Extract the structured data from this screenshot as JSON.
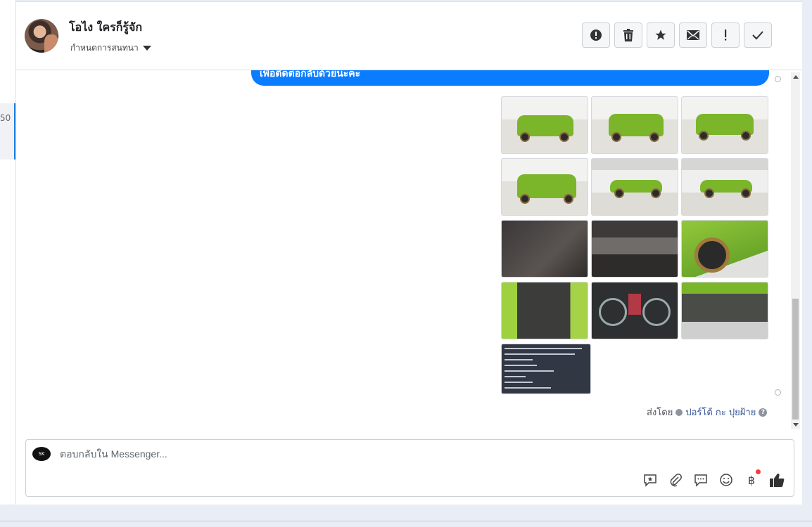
{
  "sidebar": {
    "unread_count": "50"
  },
  "header": {
    "contact_name": "โอไง ใครก็รู้จัก",
    "assign_label": "กำหนดการสนทนา",
    "actions": [
      {
        "name": "report-spam-button",
        "icon": "alert-circle-icon"
      },
      {
        "name": "delete-button",
        "icon": "trash-icon"
      },
      {
        "name": "star-button",
        "icon": "star-icon"
      },
      {
        "name": "mark-unread-button",
        "icon": "envelope-icon"
      },
      {
        "name": "follow-up-button",
        "icon": "exclamation-icon"
      },
      {
        "name": "mark-done-button",
        "icon": "checkmark-icon"
      }
    ]
  },
  "chat": {
    "last_message": "เพื่อติดต่อกลับด้วยนะคะ",
    "photos": [
      {
        "kind": "car-front",
        "bg": "light"
      },
      {
        "kind": "car-front",
        "bg": "light"
      },
      {
        "kind": "car-front",
        "bg": "light"
      },
      {
        "kind": "car-rear",
        "bg": "light"
      },
      {
        "kind": "car-side",
        "bg": "gray"
      },
      {
        "kind": "car-side",
        "bg": "gray"
      },
      {
        "kind": "interior",
        "bg": "dark"
      },
      {
        "kind": "interior",
        "bg": "dark2"
      },
      {
        "kind": "wheel",
        "bg": "greenbody"
      },
      {
        "kind": "door",
        "bg": "door"
      },
      {
        "kind": "dashboard",
        "bg": "dash"
      },
      {
        "kind": "engine",
        "bg": "engine"
      }
    ],
    "sent_by_label": "ส่งโดย",
    "sent_by_name": "ปอร์โต้ กะ ปุยฝ้าย",
    "help_icon": "?"
  },
  "composer": {
    "page_avatar_text": "SK",
    "placeholder": "ตอบกลับใน Messenger...",
    "tools": [
      "saved-reply-icon",
      "attachment-icon",
      "chat-bubble-icon",
      "emoji-icon",
      "baht-icon",
      "thumbs-up-icon"
    ],
    "baht_symbol": "฿"
  },
  "colors": {
    "messenger_blue": "#0a7cff",
    "accent_selected": "#1a7ce0"
  }
}
